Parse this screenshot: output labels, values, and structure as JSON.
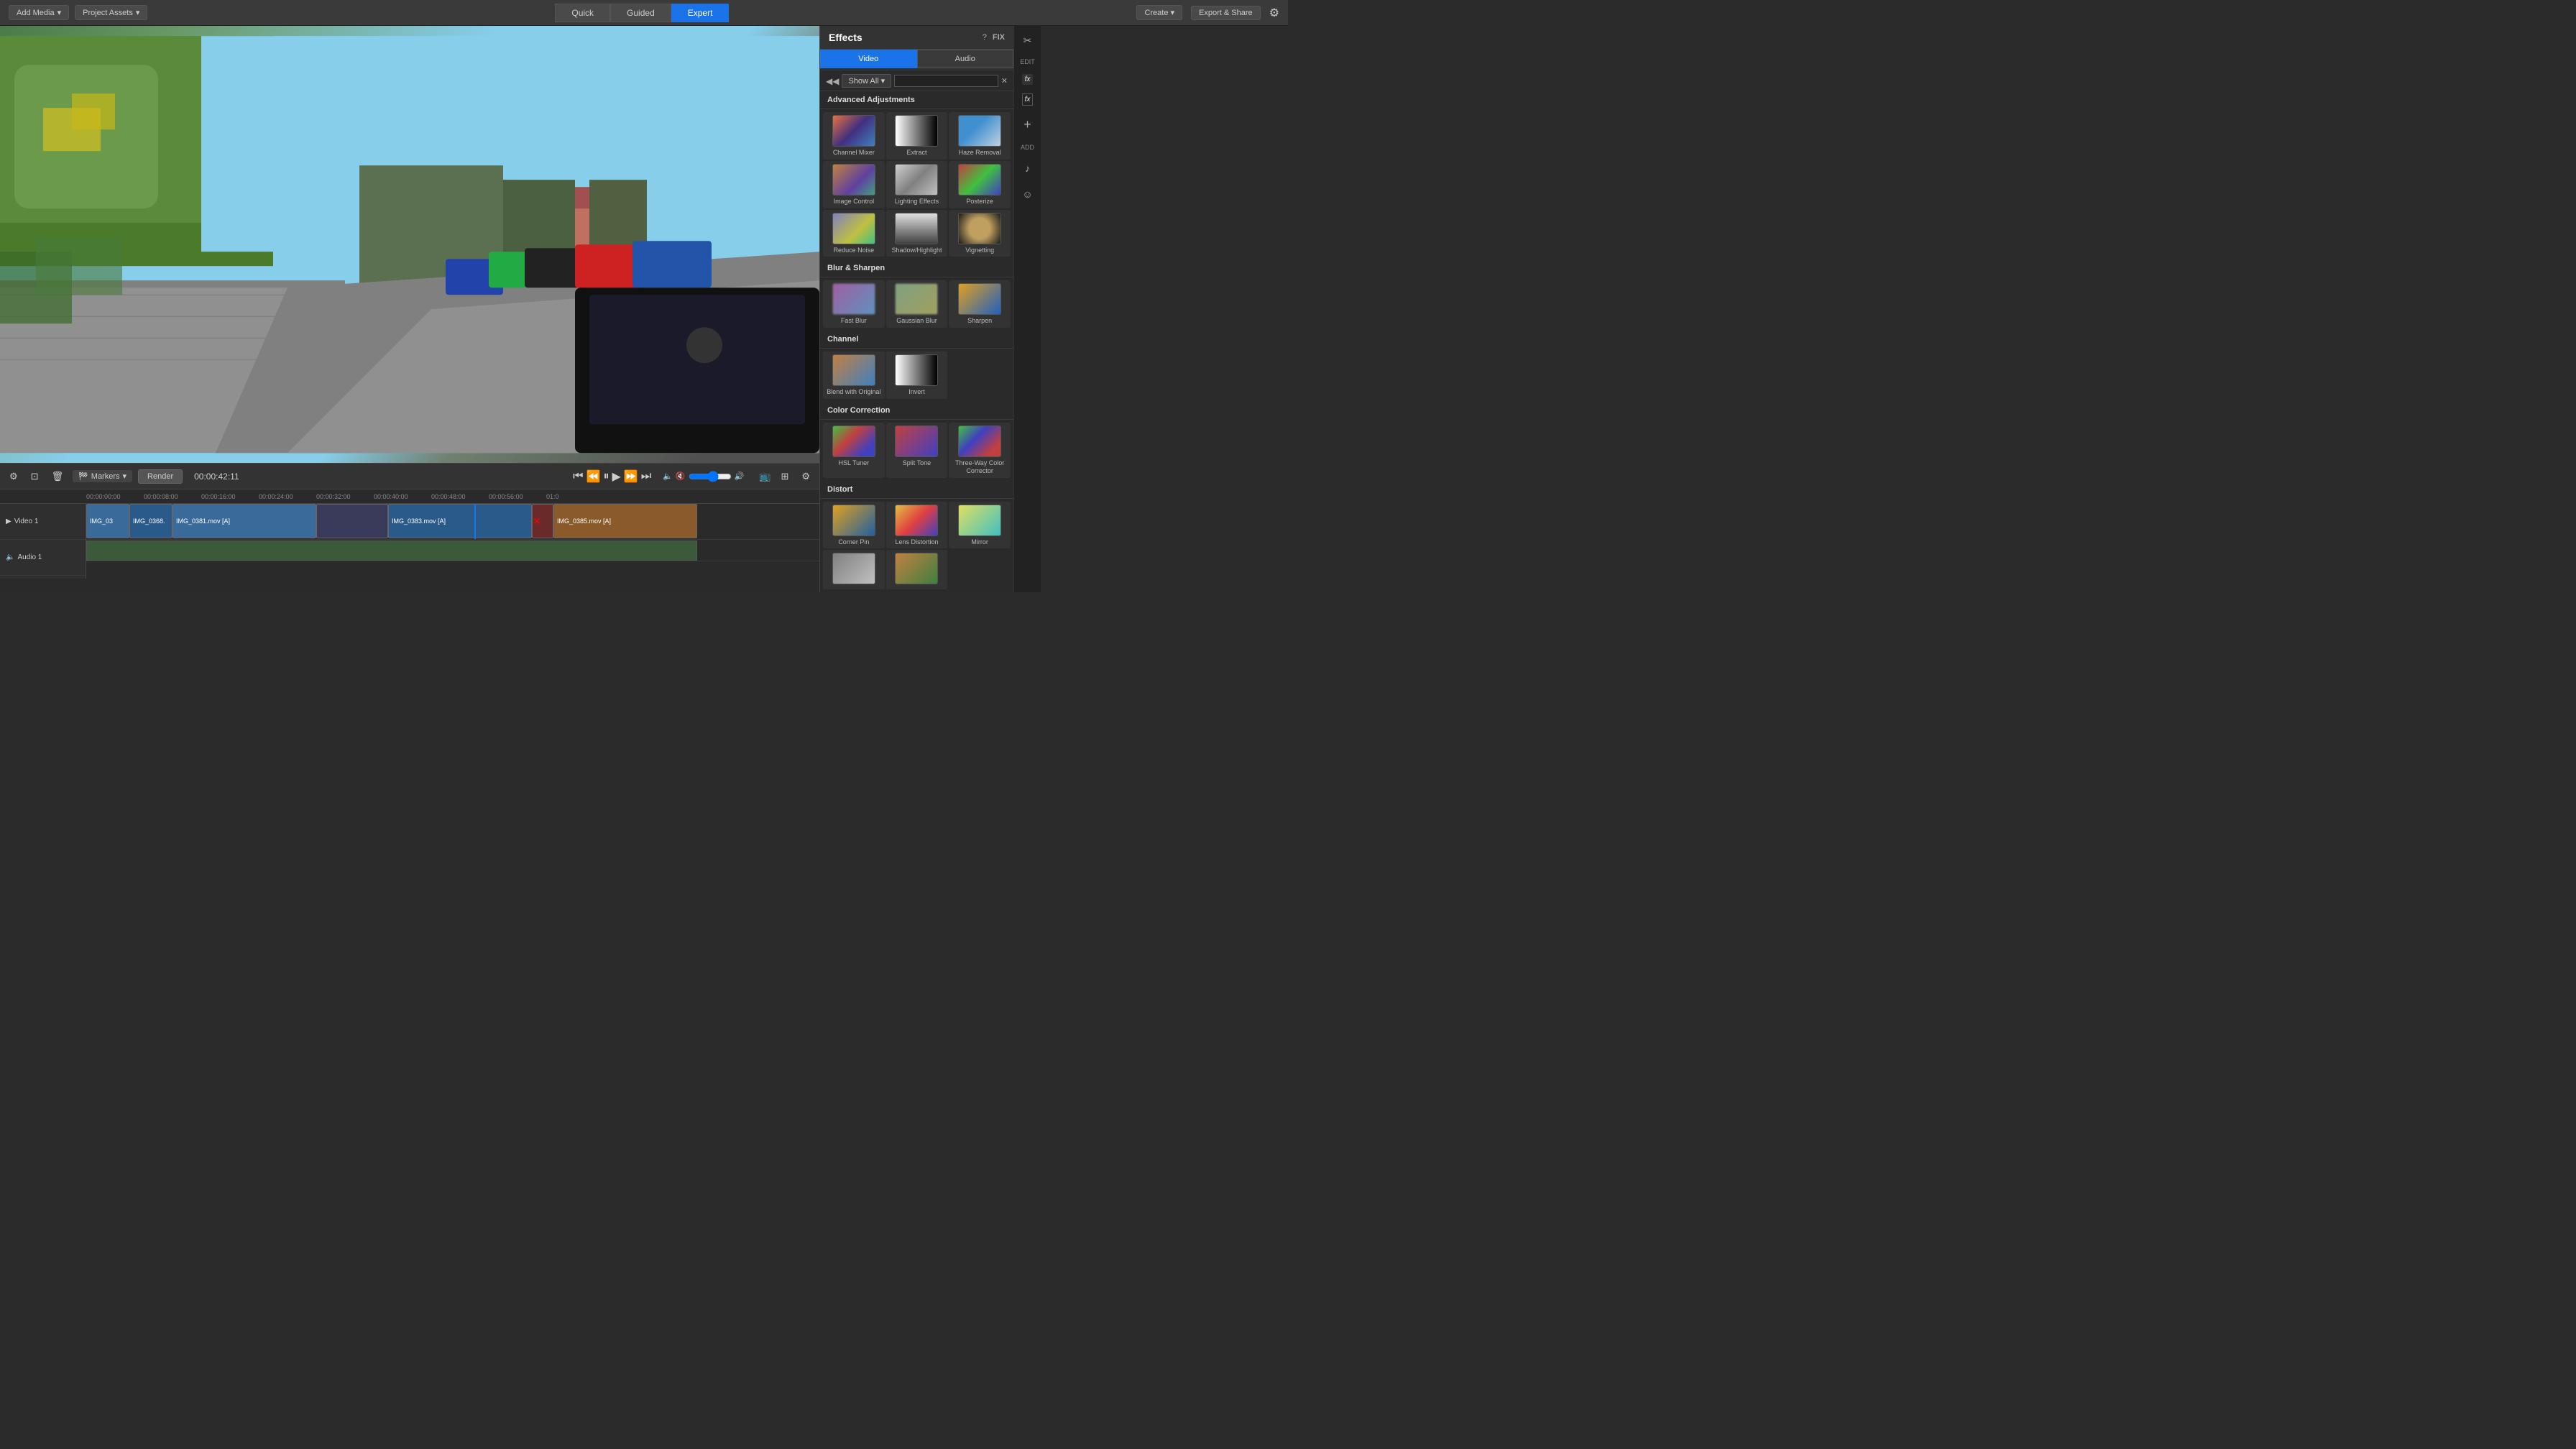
{
  "topbar": {
    "add_media_label": "Add Media",
    "project_assets_label": "Project Assets",
    "mode_quick": "Quick",
    "mode_guided": "Guided",
    "mode_expert": "Expert",
    "create_label": "Create",
    "export_label": "Export & Share",
    "active_mode": "Expert"
  },
  "timeline": {
    "markers_label": "Markers",
    "render_label": "Render",
    "timecode": "00:00:42:11",
    "tracks": [
      {
        "name": "Video 1",
        "clips": [
          {
            "label": "IMG_03",
            "class": "clip-blue"
          },
          {
            "label": "IMG_0368.",
            "class": "clip-blue2"
          },
          {
            "label": "IMG_0381.mov [A]",
            "class": "clip-blue"
          },
          {
            "label": "",
            "class": "clip-dark"
          },
          {
            "label": "IMG_0383.mov [A]",
            "class": "clip-blue2"
          },
          {
            "label": "",
            "class": "clip-red"
          },
          {
            "label": "IMG_0385.mov [A]",
            "class": "clip-orange"
          }
        ]
      },
      {
        "name": "Audio 1",
        "clips": []
      }
    ],
    "ruler_ticks": [
      "00:00:00:00",
      "00:00:08:00",
      "00:00:16:00",
      "00:00:24:00",
      "00:00:32:00",
      "00:00:40:00",
      "00:00:48:00",
      "00:00:56:00",
      "01:0"
    ]
  },
  "effects_panel": {
    "title": "Effects",
    "help_icon": "?",
    "fix_label": "FIX",
    "tab_video": "Video",
    "tab_audio": "Audio",
    "show_all_label": "Show All",
    "filter_placeholder": "",
    "sections": [
      {
        "title": "Advanced Adjustments",
        "items": [
          {
            "label": "Channel Mixer",
            "thumb": "thumb-channel-mixer"
          },
          {
            "label": "Extract",
            "thumb": "thumb-extract"
          },
          {
            "label": "Haze Removal",
            "thumb": "thumb-haze-removal"
          },
          {
            "label": "Image Control",
            "thumb": "thumb-image-control"
          },
          {
            "label": "Lighting Effects",
            "thumb": "thumb-lighting-effects"
          },
          {
            "label": "Posterize",
            "thumb": "thumb-posterize"
          },
          {
            "label": "Reduce Noise",
            "thumb": "thumb-reduce-noise"
          },
          {
            "label": "Shadow/Highlight",
            "thumb": "thumb-shadow-highlight"
          },
          {
            "label": "Vignetting",
            "thumb": "thumb-vignetting"
          }
        ]
      },
      {
        "title": "Blur & Sharpen",
        "items": [
          {
            "label": "Fast Blur",
            "thumb": "thumb-fast-blur"
          },
          {
            "label": "Gaussian Blur",
            "thumb": "thumb-gaussian-blur"
          },
          {
            "label": "Sharpen",
            "thumb": "thumb-sharpen"
          }
        ]
      },
      {
        "title": "Channel",
        "items": [
          {
            "label": "Blend with Original",
            "thumb": "thumb-blend"
          },
          {
            "label": "Invert",
            "thumb": "thumb-invert"
          }
        ]
      },
      {
        "title": "Color Correction",
        "items": [
          {
            "label": "HSL Tuner",
            "thumb": "thumb-hsl"
          },
          {
            "label": "Split Tone",
            "thumb": "thumb-split-tone"
          },
          {
            "label": "Three-Way Color Corrector",
            "thumb": "thumb-three-way"
          }
        ]
      },
      {
        "title": "Distort",
        "items": [
          {
            "label": "Corner Pin",
            "thumb": "thumb-corner-pin"
          },
          {
            "label": "Lens Distortion",
            "thumb": "thumb-lens-distortion"
          },
          {
            "label": "Mirror",
            "thumb": "thumb-mirror"
          }
        ]
      }
    ]
  },
  "side_icons": [
    {
      "icon": "✂",
      "label": "EDIT"
    },
    {
      "icon": "fx",
      "label": ""
    },
    {
      "icon": "fx",
      "label": ""
    },
    {
      "icon": "+",
      "label": "ADD"
    },
    {
      "icon": "♪",
      "label": ""
    },
    {
      "icon": "☺",
      "label": ""
    }
  ]
}
